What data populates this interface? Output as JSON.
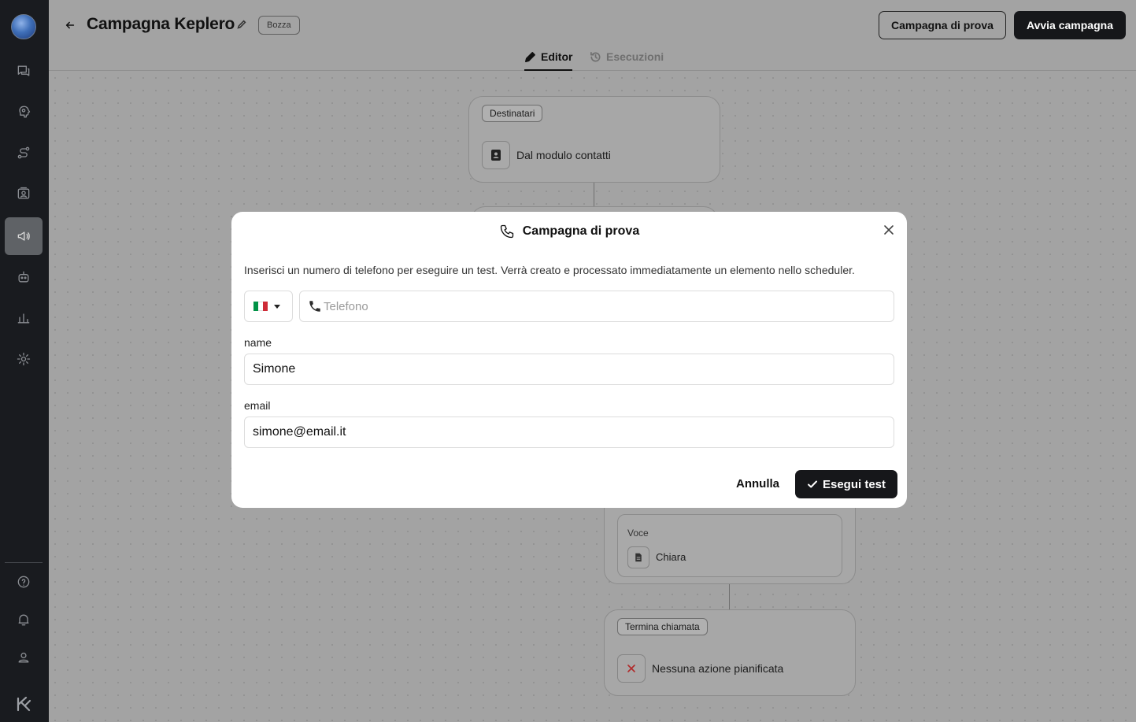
{
  "header": {
    "title": "Campagna Keplero",
    "status_badge": "Bozza",
    "test_button": "Campagna di prova",
    "start_button": "Avvia campagna"
  },
  "tabs": [
    {
      "label": "Editor",
      "active": true,
      "icon": "pencil-icon"
    },
    {
      "label": "Esecuzioni",
      "active": false,
      "icon": "history-icon"
    }
  ],
  "sidebar": {
    "items": [
      {
        "name": "conversations",
        "icon": "chat-icon",
        "active": false
      },
      {
        "name": "knowledge",
        "icon": "brain-icon",
        "active": false
      },
      {
        "name": "flows",
        "icon": "route-icon",
        "active": false
      },
      {
        "name": "contacts",
        "icon": "contacts-icon",
        "active": false
      },
      {
        "name": "campaigns",
        "icon": "megaphone-icon",
        "active": true
      },
      {
        "name": "agents",
        "icon": "bot-icon",
        "active": false
      },
      {
        "name": "analytics",
        "icon": "bar-chart-icon",
        "active": false
      },
      {
        "name": "settings",
        "icon": "gear-icon",
        "active": false
      }
    ],
    "bottom_items": [
      {
        "name": "help",
        "icon": "help-icon"
      },
      {
        "name": "notifications",
        "icon": "bell-icon"
      },
      {
        "name": "profile",
        "icon": "user-icon"
      }
    ]
  },
  "flow": {
    "recipients_card": {
      "chip": "Destinatari",
      "label": "Dal modulo contatti"
    },
    "voice_card": {
      "label": "Voce",
      "value": "Chiara"
    },
    "end_card": {
      "chip": "Termina chiamata",
      "label": "Nessuna azione pianificata"
    }
  },
  "modal": {
    "title": "Campagna di prova",
    "description": "Inserisci un numero di telefono per eseguire un test. Verrà creato e processato immediatamente un elemento nello scheduler.",
    "country_code": "IT",
    "phone_placeholder": "Telefono",
    "phone_value": "",
    "fields": [
      {
        "label": "name",
        "value": "Simone"
      },
      {
        "label": "email",
        "value": "simone@email.it"
      }
    ],
    "cancel_label": "Annulla",
    "submit_label": "Esegui test"
  },
  "colors": {
    "primary_dark": "#16171a",
    "sidebar_bg": "#191b1f",
    "overlay_bg": "#a3a3a3",
    "flag_green": "#009246",
    "flag_white": "#ffffff",
    "flag_red": "#ce2b37"
  }
}
